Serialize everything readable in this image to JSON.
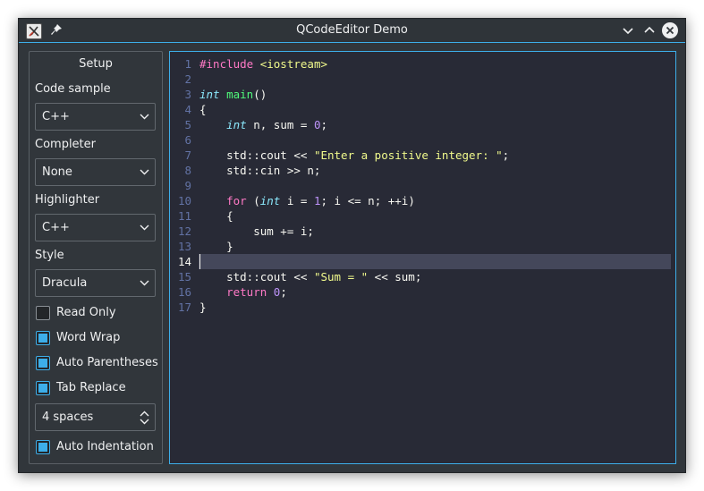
{
  "window": {
    "title": "QCodeEditor Demo",
    "accent": "#3daee9",
    "background": "#31363b"
  },
  "setup": {
    "title": "Setup",
    "code_sample_label": "Code sample",
    "code_sample_value": "C++",
    "completer_label": "Completer",
    "completer_value": "None",
    "highlighter_label": "Highlighter",
    "highlighter_value": "C++",
    "style_label": "Style",
    "style_value": "Dracula",
    "read_only_label": "Read Only",
    "read_only_checked": false,
    "word_wrap_label": "Word Wrap",
    "word_wrap_checked": true,
    "auto_parentheses_label": "Auto Parentheses",
    "auto_parentheses_checked": true,
    "tab_replace_label": "Tab Replace",
    "tab_replace_checked": true,
    "tab_size_value": "4 spaces",
    "auto_indentation_label": "Auto Indentation",
    "auto_indentation_checked": true
  },
  "editor": {
    "current_line": 14,
    "line_numbers": [
      "1",
      "2",
      "3",
      "4",
      "5",
      "6",
      "7",
      "8",
      "9",
      "10",
      "11",
      "12",
      "13",
      "14",
      "15",
      "16",
      "17"
    ],
    "lines": [
      [
        {
          "t": "pre",
          "s": "#include "
        },
        {
          "t": "str",
          "s": "<iostream>"
        }
      ],
      [],
      [
        {
          "t": "type",
          "s": "int"
        },
        {
          "t": "plain",
          "s": " "
        },
        {
          "t": "fn",
          "s": "main"
        },
        {
          "t": "plain",
          "s": "()"
        }
      ],
      [
        {
          "t": "plain",
          "s": "{"
        }
      ],
      [
        {
          "t": "plain",
          "s": "    "
        },
        {
          "t": "type",
          "s": "int"
        },
        {
          "t": "plain",
          "s": " n, sum = "
        },
        {
          "t": "num",
          "s": "0"
        },
        {
          "t": "plain",
          "s": ";"
        }
      ],
      [],
      [
        {
          "t": "plain",
          "s": "    std::cout << "
        },
        {
          "t": "str",
          "s": "\"Enter a positive integer: \""
        },
        {
          "t": "plain",
          "s": ";"
        }
      ],
      [
        {
          "t": "plain",
          "s": "    std::cin >> n;"
        }
      ],
      [],
      [
        {
          "t": "plain",
          "s": "    "
        },
        {
          "t": "kw",
          "s": "for"
        },
        {
          "t": "plain",
          "s": " ("
        },
        {
          "t": "type",
          "s": "int"
        },
        {
          "t": "plain",
          "s": " i = "
        },
        {
          "t": "num",
          "s": "1"
        },
        {
          "t": "plain",
          "s": "; i <= n; ++i)"
        }
      ],
      [
        {
          "t": "plain",
          "s": "    {"
        }
      ],
      [
        {
          "t": "plain",
          "s": "        sum += i;"
        }
      ],
      [
        {
          "t": "plain",
          "s": "    }"
        }
      ],
      [],
      [
        {
          "t": "plain",
          "s": "    std::cout << "
        },
        {
          "t": "str",
          "s": "\"Sum = \""
        },
        {
          "t": "plain",
          "s": " << sum;"
        }
      ],
      [
        {
          "t": "plain",
          "s": "    "
        },
        {
          "t": "kw",
          "s": "return"
        },
        {
          "t": "plain",
          "s": " "
        },
        {
          "t": "num",
          "s": "0"
        },
        {
          "t": "plain",
          "s": ";"
        }
      ],
      [
        {
          "t": "plain",
          "s": "}"
        }
      ]
    ]
  }
}
